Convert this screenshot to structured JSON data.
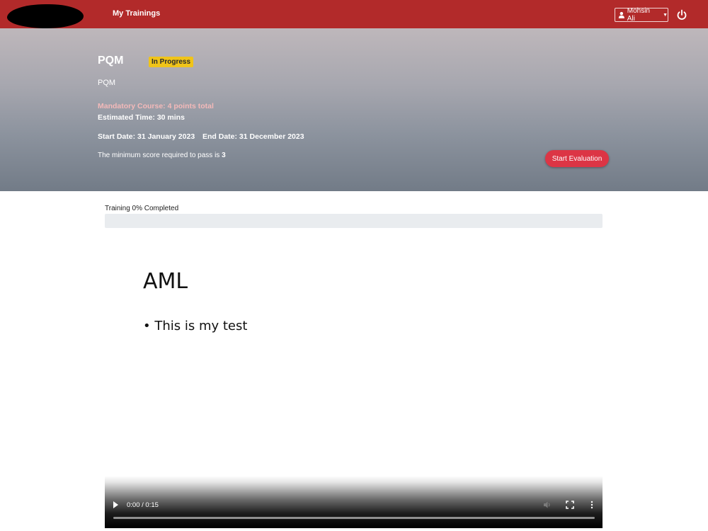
{
  "nav": {
    "link": "My Trainings",
    "user": "Mohsin Ali"
  },
  "course": {
    "title": "PQM",
    "status": "In Progress",
    "subtitle": "PQM",
    "mandatory": "Mandatory Course: 4 points total",
    "estimated_time": "Estimated Time: 30 mins",
    "start_date": "Start Date: 31 January 2023",
    "end_date": "End Date: 31 December 2023",
    "min_score_text": "The minimum score required to pass is ",
    "min_score_value": "3",
    "start_button": "Start Evaluation"
  },
  "progress": {
    "label": "Training 0% Completed",
    "percent": 0
  },
  "slide": {
    "title": "AML",
    "bullet": "• This is my test"
  },
  "video": {
    "time": "0:00 / 0:15"
  },
  "colors": {
    "brand": "#b22a2a",
    "badge": "#f0c419",
    "button": "#dc3545"
  }
}
